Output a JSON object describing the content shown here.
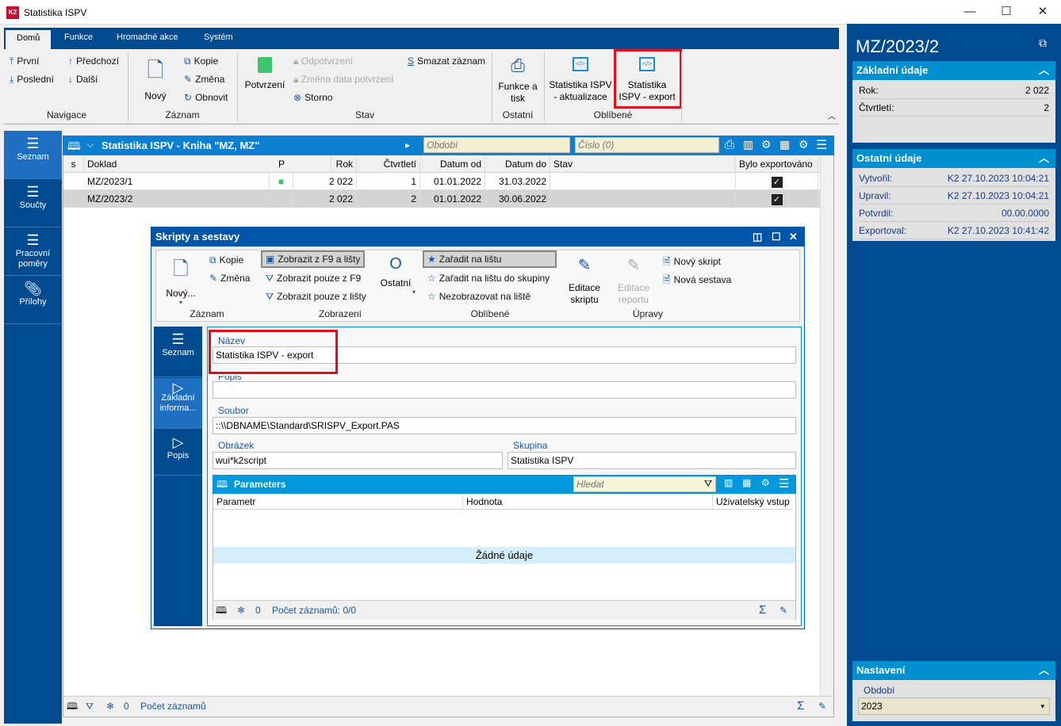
{
  "window": {
    "title": "Statistika ISPV",
    "app_icon": "k2-logo"
  },
  "ribbon": {
    "tabs": [
      "Domů",
      "Funkce",
      "Hromadné akce",
      "Systém"
    ],
    "nav": {
      "first": "První",
      "prev": "Předchozí",
      "last": "Poslední",
      "next": "Další",
      "group": "Navigace"
    },
    "record": {
      "new": "Nový",
      "copy": "Kopie",
      "change": "Změna",
      "refresh": "Obnovit",
      "group": "Záznam"
    },
    "state": {
      "confirm": "Potvrzení",
      "unconfirm": "Odpotvrzení",
      "change_date": "Změna data potvrzení",
      "storno": "Storno",
      "delete": "Smazat záznam",
      "group": "Stav"
    },
    "other": {
      "print": "Funkce a tisk",
      "group": "Ostatní"
    },
    "fav": {
      "update": "Statistika ISPV - aktualizace",
      "export": "Statistika ISPV - export",
      "group": "Oblíbené"
    }
  },
  "leftnav": [
    {
      "label": "Seznam",
      "icon": "list-icon"
    },
    {
      "label": "Součty",
      "icon": "list-icon"
    },
    {
      "label": "Pracovní poměry",
      "icon": "list-icon"
    },
    {
      "label": "Přílohy",
      "icon": "paperclip-icon"
    }
  ],
  "grid": {
    "title": "Statistika ISPV - Kniha \"MZ, MZ\"",
    "period_placeholder": "Období",
    "number_placeholder": "Číslo (0)",
    "columns": [
      "s",
      "Doklad",
      "P",
      "Rok",
      "Čtvrtletí",
      "Datum od",
      "Datum do",
      "Stav",
      "Bylo exportováno"
    ],
    "rows": [
      {
        "doklad": "MZ/2023/1",
        "p": "locked",
        "rok": "2 022",
        "ctvrtleti": "1",
        "od": "01.01.2022",
        "do": "31.03.2022",
        "stav": "",
        "exported": true
      },
      {
        "doklad": "MZ/2023/2",
        "p": "",
        "rok": "2 022",
        "ctvrtleti": "2",
        "od": "01.01.2022",
        "do": "30.06.2022",
        "stav": "",
        "exported": true
      }
    ],
    "status": {
      "count": "0",
      "records": "Počet záznamů"
    }
  },
  "right": {
    "title": "MZ/2023/2",
    "basic": {
      "header": "Základní údaje",
      "rok_label": "Rok:",
      "rok": "2 022",
      "q_label": "Čtvrtletí:",
      "q": "2"
    },
    "other": {
      "header": "Ostatní údaje",
      "created_label": "Vytvořil:",
      "created": "K2 27.10.2023 10:04:21",
      "updated_label": "Upravil:",
      "updated": "K2 27.10.2023 10:04:21",
      "confirmed_label": "Potvrdil:",
      "confirmed": "00.00.0000",
      "exported_label": "Exportoval:",
      "exported": "K2 27.10.2023 10:41:42"
    },
    "settings": {
      "header": "Nastavení",
      "period_label": "Období",
      "period": "2023"
    }
  },
  "dialog": {
    "title": "Skripty a sestavy",
    "ribbon": {
      "new": "Nový...",
      "copy": "Kopie",
      "change": "Změna",
      "g1": "Záznam",
      "show_f9_bar": "Zobrazit z F9 a lišty",
      "show_f9": "Zobrazit pouze z F9",
      "show_bar": "Zobrazit pouze z lišty",
      "other": "Ostatní",
      "g2": "Zobrazení",
      "add_bar": "Zařadit na lištu",
      "add_bar_group": "Zařadit na lištu do skupiny",
      "hide_bar": "Nezobrazovat na liště",
      "g3": "Oblíbené",
      "edit_script": "Editace skriptu",
      "edit_report": "Editace reportu",
      "new_script": "Nový skript",
      "new_report": "Nová sestava",
      "g4": "Úpravy"
    },
    "nav": [
      "Seznam",
      "Základní informa...",
      "Popis"
    ],
    "form": {
      "name_label": "Název",
      "name": "Statistika ISPV - export",
      "desc_label": "Popis",
      "desc": "",
      "file_label": "Soubor",
      "file": "::\\\\DBNAME\\Standard\\SRISPV_Export.PAS",
      "image_label": "Obrázek",
      "image": "wui*k2script",
      "group_label": "Skupina",
      "group": "Statistika ISPV"
    },
    "params": {
      "title": "Parameters",
      "search_placeholder": "Hledat",
      "columns": [
        "Parametr",
        "Hodnota",
        "Uživatelský vstup"
      ],
      "empty": "Žádné údaje",
      "count": "0",
      "records": "Počet záznamů: 0/0"
    }
  },
  "colors": {
    "ribbon_blue": "#004a8f",
    "grid_header": "#0c7fd0",
    "section_header": "#0090d0",
    "highlight": "#e0101a",
    "lock_green": "#3cc46e"
  }
}
